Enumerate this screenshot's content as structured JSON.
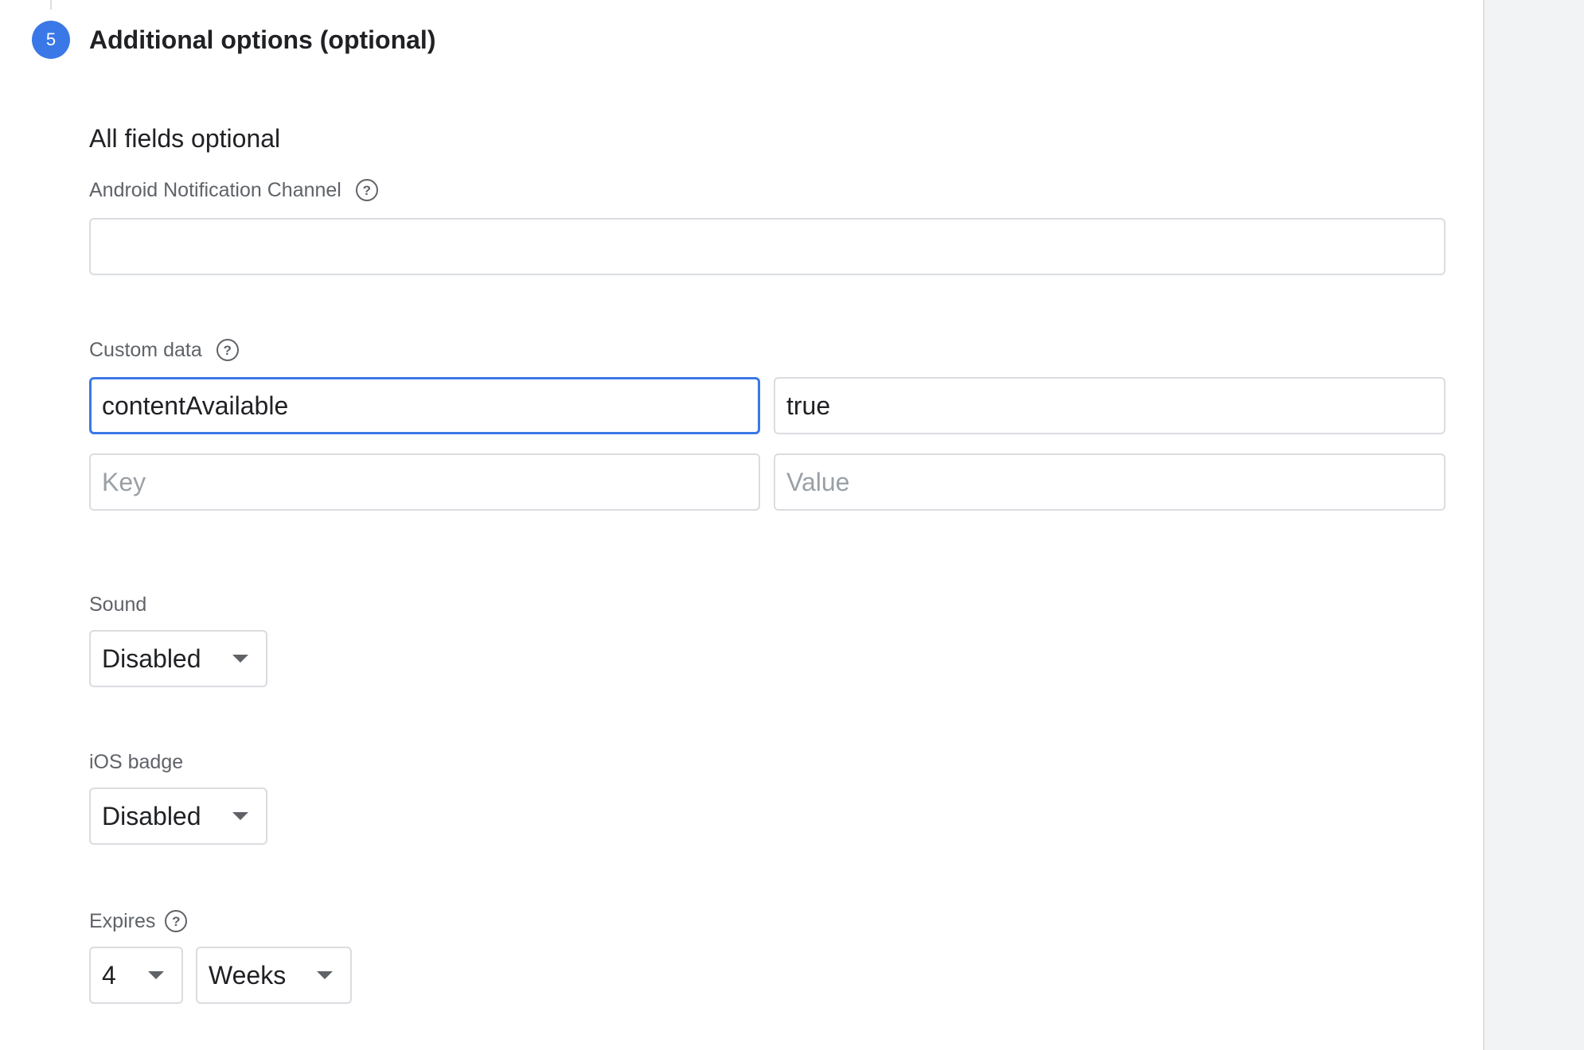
{
  "step": {
    "number": "5",
    "title": "Additional options (optional)"
  },
  "section": {
    "subtitle": "All fields optional"
  },
  "android_channel": {
    "label": "Android Notification Channel",
    "value": ""
  },
  "custom_data": {
    "label": "Custom data",
    "rows": [
      {
        "key": "contentAvailable",
        "value": "true"
      },
      {
        "key": "",
        "value": ""
      }
    ],
    "key_placeholder": "Key",
    "value_placeholder": "Value"
  },
  "sound": {
    "label": "Sound",
    "selected": "Disabled"
  },
  "ios_badge": {
    "label": "iOS badge",
    "selected": "Disabled"
  },
  "expires": {
    "label": "Expires",
    "amount": "4",
    "unit": "Weeks"
  },
  "icons": {
    "help": "help-circle-icon",
    "dropdown": "arrow-drop-down-icon"
  },
  "colors": {
    "accent": "#3b78e7",
    "border": "#dadce0",
    "label": "#5f6368",
    "side_panel": "#f1f3f4"
  }
}
